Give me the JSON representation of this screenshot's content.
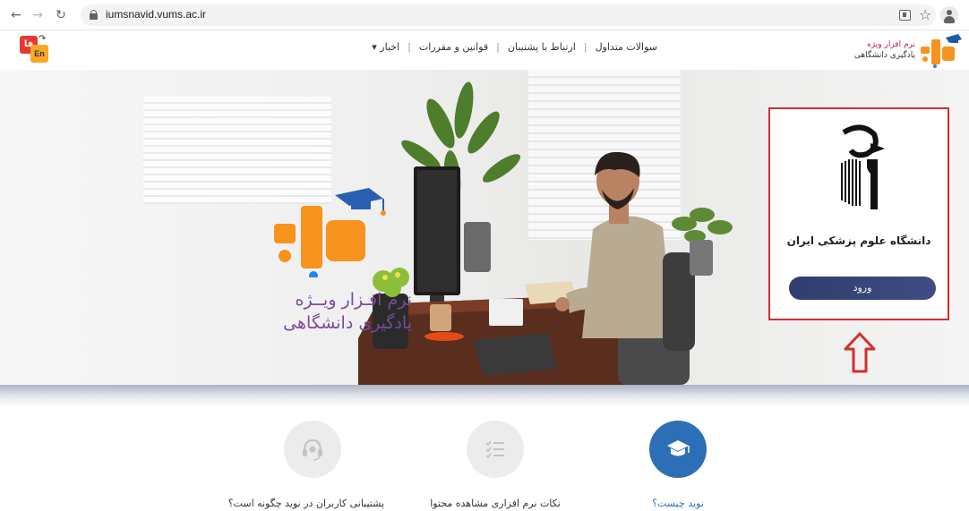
{
  "browser": {
    "url": "iumsnavid.vums.ac.ir",
    "icons": [
      "back-arrow-icon",
      "forward-arrow-icon",
      "reload-icon",
      "lock-icon",
      "translate-icon",
      "star-icon",
      "profile-icon"
    ]
  },
  "header": {
    "nav": [
      {
        "label": "سوالات متداول"
      },
      {
        "label": "ارتباط با پشتیبان"
      },
      {
        "label": "قوانین و مقررات"
      },
      {
        "label": "اخبار ▾"
      }
    ],
    "brand_line1": "نرم افزار ویژه",
    "brand_line2": "یادگیری دانشگاهی",
    "lang_fa": "فا",
    "lang_en": "En"
  },
  "hero": {
    "slogan_line1": "نرم افـزار ویــژه",
    "slogan_line2": "یادگیری دانشگاهی"
  },
  "login_card": {
    "university": "دانشگاه علوم پزشکی ایران",
    "login_label": "ورود"
  },
  "features": [
    {
      "label": "نوید چیست؟",
      "icon": "graduation-cap-icon",
      "active": true
    },
    {
      "label": "نکات نرم افزاری مشاهده محتوا",
      "icon": "checklist-icon",
      "active": false
    },
    {
      "label": "پشتیبانی کاربران در نوید چگونه است؟",
      "icon": "headset-icon",
      "active": false
    }
  ],
  "colors": {
    "accent": "#2c6fb7",
    "login_button": "#2f3e6e",
    "highlight_border": "#d32f2f",
    "brand_orange": "#f7931e",
    "brand_purple": "#7a4b9a"
  }
}
